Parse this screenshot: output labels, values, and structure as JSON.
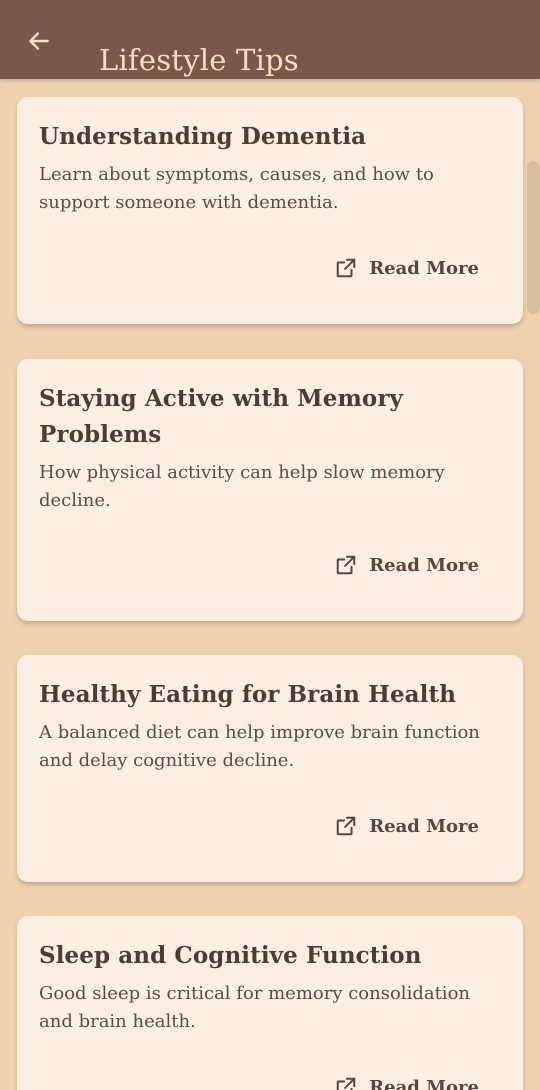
{
  "appbar": {
    "title": "Lifestyle Tips",
    "back_icon": "arrow-left-icon"
  },
  "cards": [
    {
      "title": "Understanding Dementia",
      "description": "Learn about symptoms, causes, and how to support someone with dementia.",
      "action_label": "Read More",
      "action_icon": "open-in-new-icon"
    },
    {
      "title": "Staying Active with Memory Problems",
      "description": "How physical activity can help slow memory decline.",
      "action_label": "Read More",
      "action_icon": "open-in-new-icon"
    },
    {
      "title": "Healthy Eating for Brain Health",
      "description": "A balanced diet can help improve brain function and delay cognitive decline.",
      "action_label": "Read More",
      "action_icon": "open-in-new-icon"
    },
    {
      "title": "Sleep and Cognitive Function",
      "description": "Good sleep is critical for memory consolidation and brain health.",
      "action_label": "Read More",
      "action_icon": "open-in-new-icon"
    }
  ],
  "colors": {
    "appbar_bg": "#78584A",
    "appbar_text": "#F7DEC0",
    "page_bg": "#EFD3B1",
    "card_bg": "#FCEEE0",
    "text_primary": "#4E3B33"
  }
}
